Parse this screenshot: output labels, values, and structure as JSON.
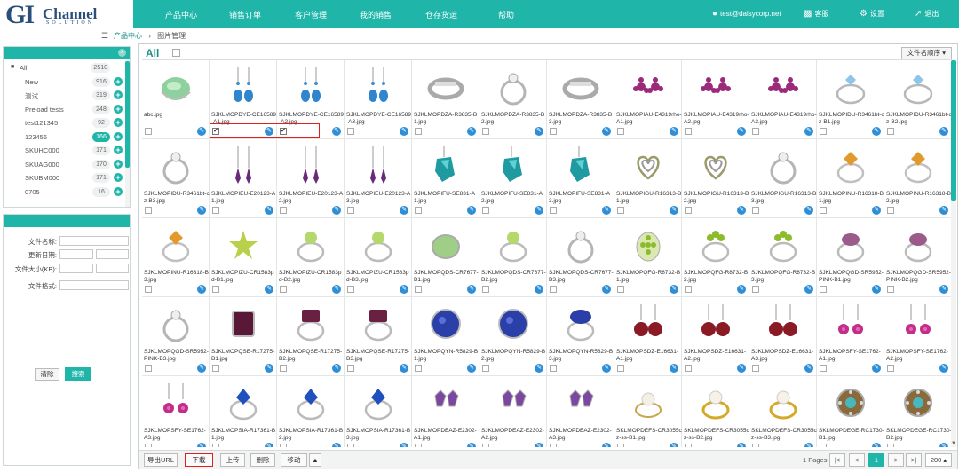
{
  "logo": {
    "letters": "GI",
    "name": "Channel",
    "tagline": "SOLUTION"
  },
  "nav": {
    "items": [
      "产品中心",
      "销售订单",
      "客户管理",
      "我的销售",
      "仓存货运",
      "帮助"
    ],
    "user": "test@daisycorp.net",
    "service": "客服",
    "settings": "设置",
    "logout": "退出"
  },
  "breadcrumb": {
    "home": "产品中心",
    "sep": "›",
    "current": "图片管理"
  },
  "folders": [
    {
      "label": "All",
      "count": "2510",
      "root": true
    },
    {
      "label": "New",
      "count": "916"
    },
    {
      "label": "测试",
      "count": "319"
    },
    {
      "label": "Preload tests",
      "count": "248"
    },
    {
      "label": "test121345",
      "count": "92"
    },
    {
      "label": "123456",
      "count": "166",
      "active": true
    },
    {
      "label": "SKUHC000",
      "count": "171"
    },
    {
      "label": "SKUAG000",
      "count": "170"
    },
    {
      "label": "SKUBM000",
      "count": "171"
    },
    {
      "label": "0705",
      "count": "16"
    }
  ],
  "filter": {
    "name_label": "文件名称:",
    "date_label": "更新日期:",
    "size_label": "文件大小(KB):",
    "format_label": "文件格式:",
    "clear": "清除",
    "search": "搜索"
  },
  "grid": {
    "all_label": "All",
    "sort": "文件名顺序 ▾",
    "items": [
      {
        "name": "abc.jpg",
        "type": "jade"
      },
      {
        "name": "SJKLMOPDYE-CE16589-A1.jpg",
        "type": "blue-earring",
        "checked": true
      },
      {
        "name": "SJKLMOPDYE-CE16589-A2.jpg",
        "type": "blue-earring",
        "checked": true
      },
      {
        "name": "SJKLMOPDYE-CE16589-A3.jpg",
        "type": "blue-earring"
      },
      {
        "name": "SJKLMOPDZA-R3835-B1.jpg",
        "type": "silver-band"
      },
      {
        "name": "SJKLMOPDZA-R3835-B2.jpg",
        "type": "silver-ring"
      },
      {
        "name": "SJKLMOPDZA-R3835-B3.jpg",
        "type": "silver-band"
      },
      {
        "name": "SJKLMOPIAU-E4319rho-A1.jpg",
        "type": "purple-flower"
      },
      {
        "name": "SJKLMOPIAU-E4319rho-A2.jpg",
        "type": "purple-flower"
      },
      {
        "name": "SJKLMOPIAU-E4319rho-A3.jpg",
        "type": "purple-flower"
      },
      {
        "name": "SJKLMOPIDU-R3461bt-cz-B1.jpg",
        "type": "blue-ring"
      },
      {
        "name": "SJKLMOPIDU-R3461bt-cz-B2.jpg",
        "type": "blue-ring"
      },
      {
        "name": "SJKLMOPIDU-R3461bt-cz-B3.jpg",
        "type": "silver-ring"
      },
      {
        "name": "SJKLMOPIEU-E20123-A1.jpg",
        "type": "purple-drop"
      },
      {
        "name": "SJKLMOPIEU-E20123-A2.jpg",
        "type": "purple-drop"
      },
      {
        "name": "SJKLMOPIEU-E20123-A3.jpg",
        "type": "purple-drop"
      },
      {
        "name": "SJKLMOPIFU-SE831-A1.jpg",
        "type": "teal-crystal"
      },
      {
        "name": "SJKLMOPIFU-SE831-A2.jpg",
        "type": "teal-crystal"
      },
      {
        "name": "SJKLMOPIFU-SE831-A3.jpg",
        "type": "teal-crystal"
      },
      {
        "name": "SJKLMOPIGU-R16313-B1.jpg",
        "type": "heart-ring"
      },
      {
        "name": "SJKLMOPIGU-R16313-B2.jpg",
        "type": "heart-ring"
      },
      {
        "name": "SJKLMOPIGU-R16313-B3.jpg",
        "type": "silver-ring"
      },
      {
        "name": "SJKLMOPINU-R16318-B1.jpg",
        "type": "citrine-ring"
      },
      {
        "name": "SJKLMOPINU-R16318-B2.jpg",
        "type": "citrine-ring"
      },
      {
        "name": "SJKLMOPINU-R16318-B3.jpg",
        "type": "citrine-ring"
      },
      {
        "name": "SJKLMOPIZU-CR1583pd-B1.jpg",
        "type": "green-star"
      },
      {
        "name": "SJKLMOPIZU-CR1583pd-B2.jpg",
        "type": "green-ring"
      },
      {
        "name": "SJKLMOPIZU-CR1583pd-B3.jpg",
        "type": "green-ring"
      },
      {
        "name": "SJKLMOPQDS-CR7677-B1.jpg",
        "type": "green-oval"
      },
      {
        "name": "SJKLMOPQDS-CR7677-B2.jpg",
        "type": "green-ring"
      },
      {
        "name": "SJKLMOPQDS-CR7677-B3.jpg",
        "type": "silver-ring"
      },
      {
        "name": "SJKLMOPQFG-R8732-B1.jpg",
        "type": "peridot-oval"
      },
      {
        "name": "SJKLMOPQFG-R8732-B2.jpg",
        "type": "peridot-ring"
      },
      {
        "name": "SJKLMOPQFG-R8732-B3.jpg",
        "type": "peridot-ring"
      },
      {
        "name": "SJKLMOPQGD-SR5952-PINK-B1.jpg",
        "type": "pink-ring"
      },
      {
        "name": "SJKLMOPQGD-SR5952-PINK-B2.jpg",
        "type": "pink-ring"
      },
      {
        "name": "SJKLMOPQGD-SR5952-PINK-B3.jpg",
        "type": "silver-ring"
      },
      {
        "name": "SJKLMOPQSE-R17275-B1.jpg",
        "type": "druzy-rect"
      },
      {
        "name": "SJKLMOPQSE-R17275-B2.jpg",
        "type": "druzy-ring"
      },
      {
        "name": "SJKLMOPQSE-R17275-B3.jpg",
        "type": "druzy-ring"
      },
      {
        "name": "SJKLMOPQYN-R5829-B1.jpg",
        "type": "blue-druzy"
      },
      {
        "name": "SJKLMOPQYN-R5829-B2.jpg",
        "type": "blue-druzy"
      },
      {
        "name": "SJKLMOPQYN-R5829-B3.jpg",
        "type": "blue-druzy-ring"
      },
      {
        "name": "SJKLMOPSDZ-E16631-A1.jpg",
        "type": "red-earring"
      },
      {
        "name": "SJKLMOPSDZ-E16631-A2.jpg",
        "type": "red-earring"
      },
      {
        "name": "SJKLMOPSDZ-E16631-A3.jpg",
        "type": "red-earring"
      },
      {
        "name": "SJKLMOPSFY-SE1762-A1.jpg",
        "type": "pink-flower-earring"
      },
      {
        "name": "SJKLMOPSFY-SE1762-A2.jpg",
        "type": "pink-flower-earring"
      },
      {
        "name": "SJKLMOPSFY-SE1762-A3.jpg",
        "type": "pink-flower-earring"
      },
      {
        "name": "SJKLMOPSIA-R17361-B1.jpg",
        "type": "blue-gem-ring"
      },
      {
        "name": "SJKLMOPSIA-R17361-B2.jpg",
        "type": "blue-gem-ring"
      },
      {
        "name": "SJKLMOPSIA-R17361-B3.jpg",
        "type": "blue-gem-ring"
      },
      {
        "name": "SJKLMOPDEAZ-E2302-A1.jpg",
        "type": "amethyst-stud"
      },
      {
        "name": "SJKLMOPDEAZ-E2302-A2.jpg",
        "type": "amethyst-stud"
      },
      {
        "name": "SJKLMOPDEAZ-E2302-A3.jpg",
        "type": "amethyst-stud"
      },
      {
        "name": "SKLMOPDEFS-CR3055cz-ss-B1.jpg",
        "type": "pearl-ring"
      },
      {
        "name": "SKLMOPDEFS-CR3055cz-ss-B2.jpg",
        "type": "pearl-gold-ring"
      },
      {
        "name": "SKLMOPDEFS-CR3055cz-ss-B3.jpg",
        "type": "pearl-gold-ring"
      },
      {
        "name": "SKLMOPDEGE-RC1730-B1.jpg",
        "type": "turquoise-cluster"
      },
      {
        "name": "SKLMOPDEGE-RC1730-B2.jpg",
        "type": "turquoise-cluster"
      }
    ]
  },
  "toolbar": {
    "export": "导出URL",
    "download": "下载",
    "upload": "上传",
    "delete": "删除",
    "move": "移动",
    "move_arrow": "▲",
    "pages": "1 Pages",
    "first": "|<",
    "prev": "<",
    "current": "1",
    "next": ">",
    "last": ">|",
    "page_size": "200 ▴"
  },
  "colors": {
    "accent": "#1fb5a8",
    "edit_icon": "#2f8fd6",
    "highlight": "#e02020"
  }
}
